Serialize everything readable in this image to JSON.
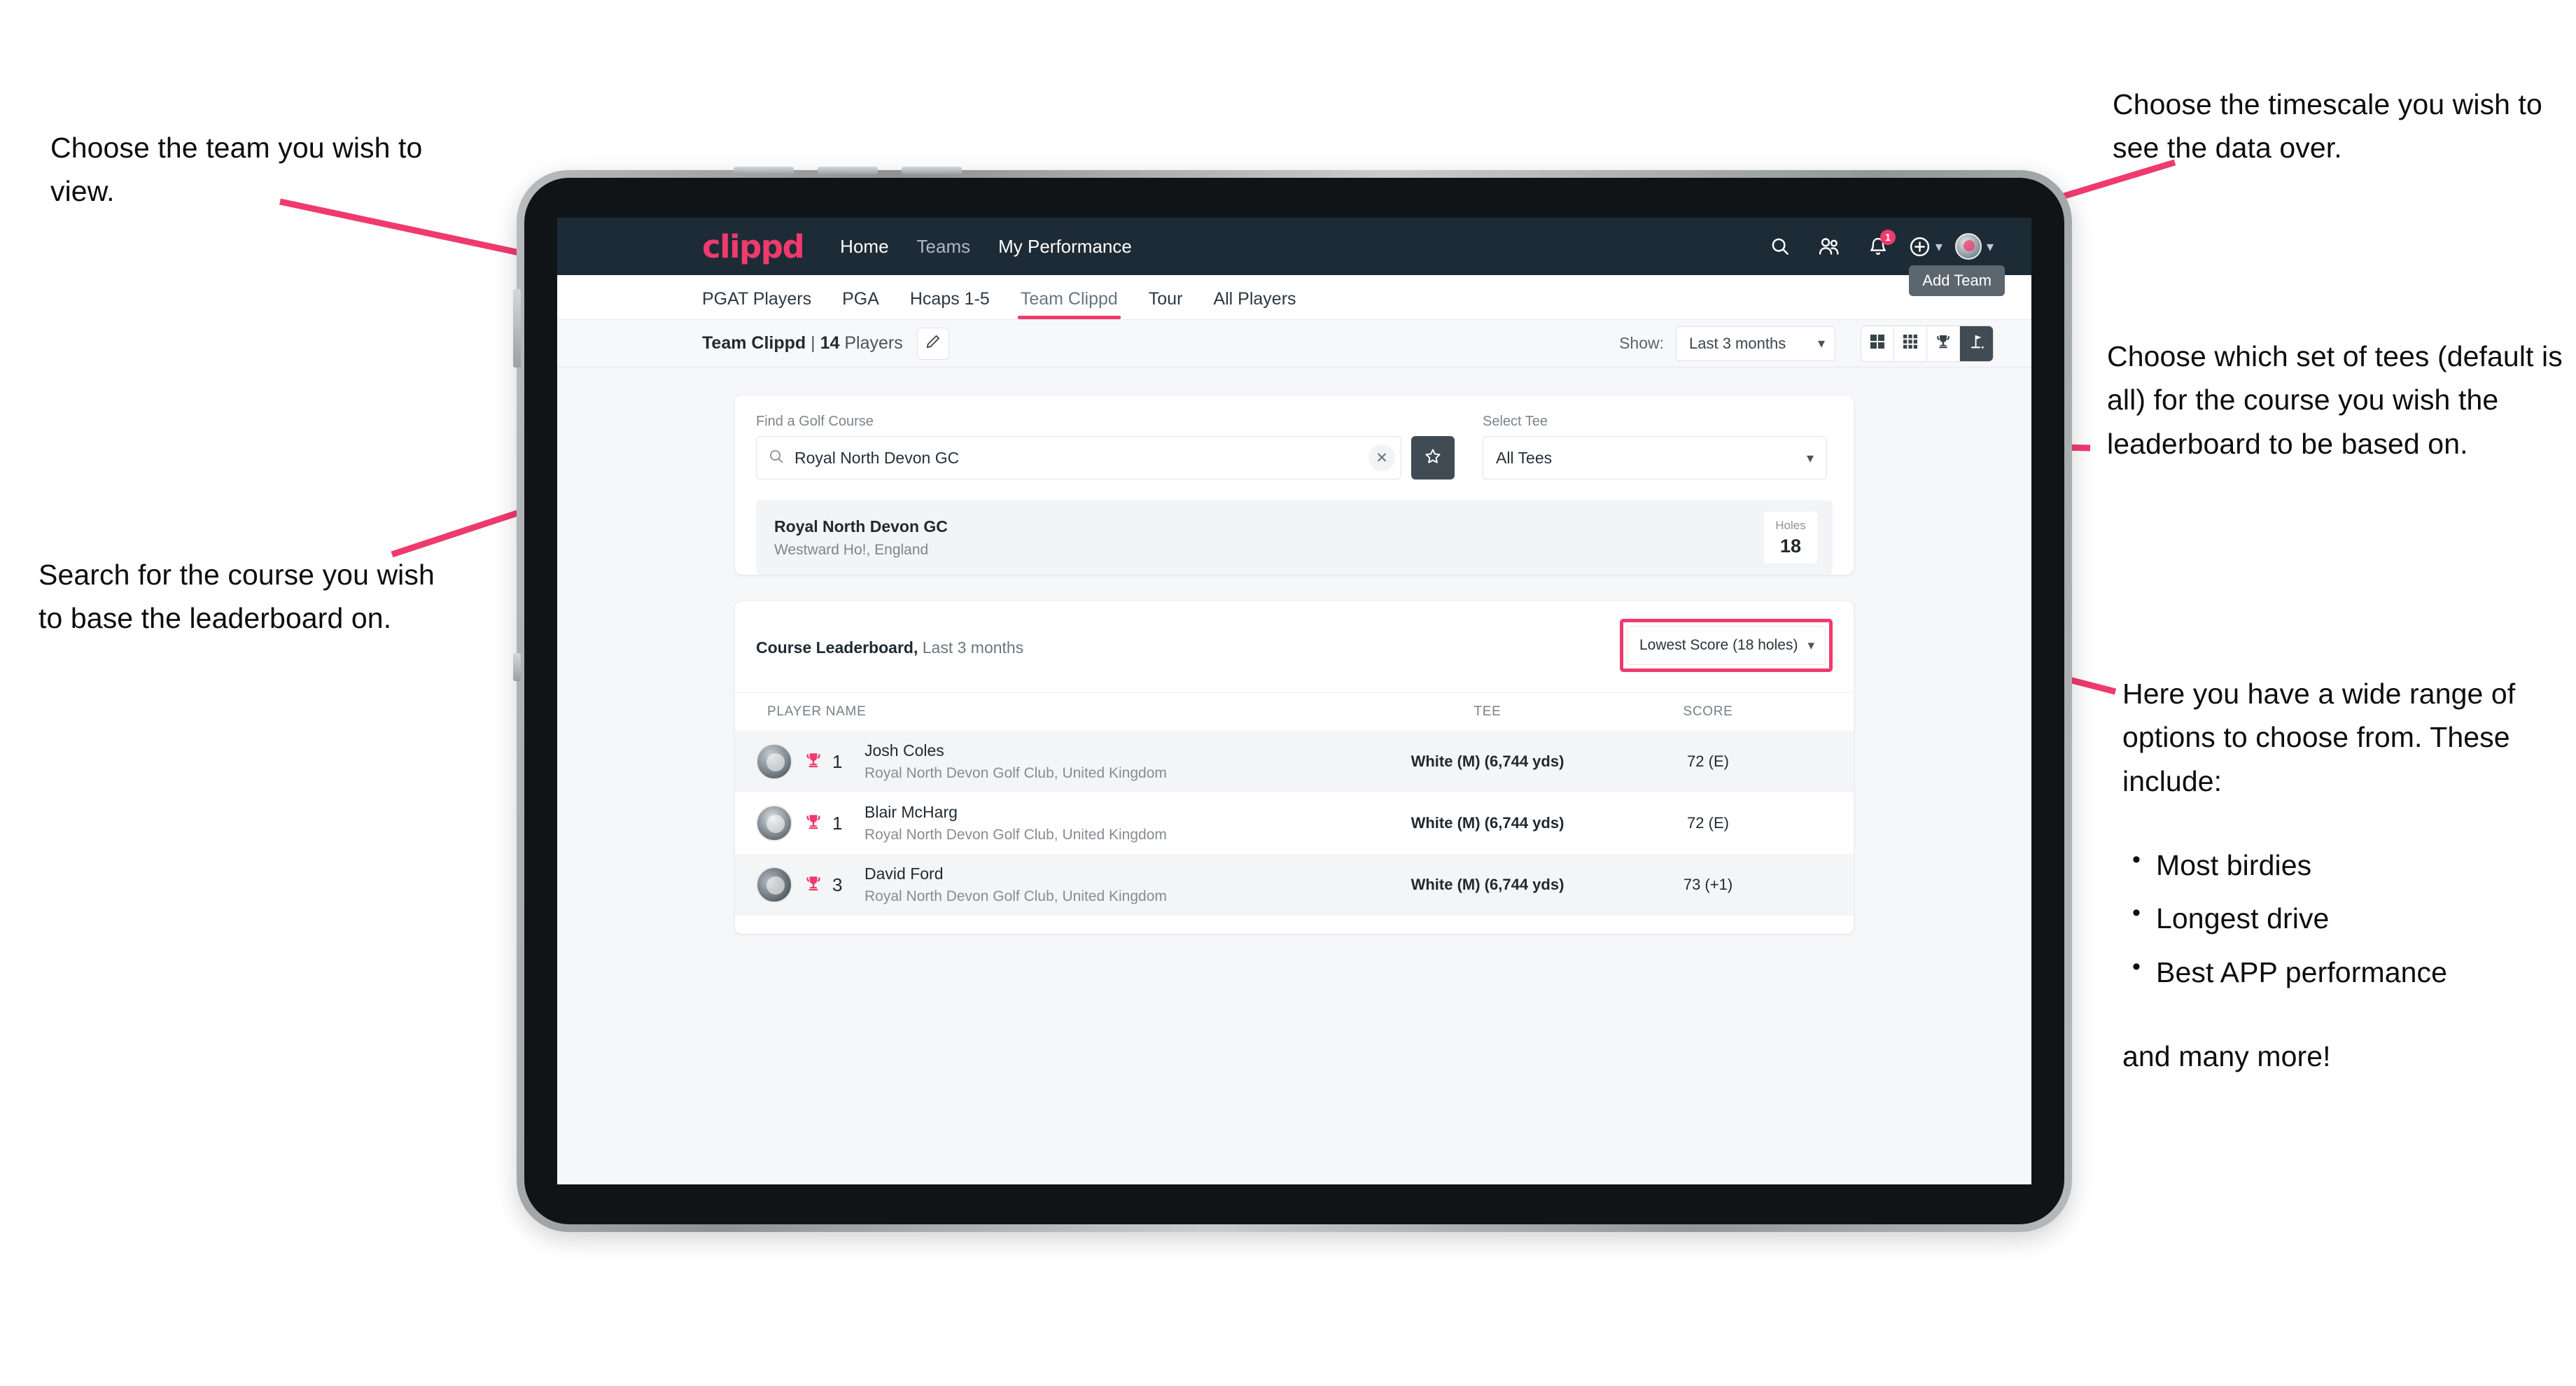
{
  "annotations": {
    "team": "Choose the team you wish to view.",
    "search": "Search for the course you wish to base the leaderboard on.",
    "timescale": "Choose the timescale you wish to see the data over.",
    "tees": "Choose which set of tees (default is all) for the course you wish the leaderboard to be based on.",
    "options_intro": "Here you have a wide range of options to choose from. These include:",
    "options_list": [
      "Most birdies",
      "Longest drive",
      "Best APP performance"
    ],
    "options_tail": "and many more!"
  },
  "appbar": {
    "brand": "clippd",
    "nav": [
      {
        "label": "Home",
        "active": true
      },
      {
        "label": "Teams",
        "active": false
      },
      {
        "label": "My Performance",
        "active": true
      }
    ],
    "icons": {
      "search": "search-icon",
      "people": "people-icon",
      "notifications": "bell-icon",
      "notification_count": "1",
      "add": "plus-circle-icon",
      "profile": "avatar-icon"
    }
  },
  "tabs": [
    {
      "label": "PGAT Players",
      "active": false
    },
    {
      "label": "PGA",
      "active": false
    },
    {
      "label": "Hcaps 1-5",
      "active": false
    },
    {
      "label": "Team Clippd",
      "active": true
    },
    {
      "label": "Tour",
      "active": false
    },
    {
      "label": "All Players",
      "active": false
    }
  ],
  "tooltip": {
    "add_team": "Add Team"
  },
  "subbar": {
    "team_name": "Team Clippd",
    "separator": "|",
    "player_count": "14",
    "players_word": "Players",
    "edit_icon": "pencil-icon",
    "show_label": "Show:",
    "show_value": "Last 3 months",
    "view_toggles": [
      {
        "icon": "grid-2x2-icon",
        "active": false
      },
      {
        "icon": "grid-3x3-icon",
        "active": false
      },
      {
        "icon": "trophy-icon",
        "active": false
      },
      {
        "icon": "golf-flag-icon",
        "active": true
      }
    ]
  },
  "search_panel": {
    "course_label": "Find a Golf Course",
    "course_value": "Royal North Devon GC",
    "course_placeholder": "Find a Golf Course",
    "clear_icon": "close-icon",
    "favourite_icon": "star-icon",
    "tee_label": "Select Tee",
    "tee_value": "All Tees"
  },
  "course_result": {
    "name": "Royal North Devon GC",
    "location": "Westward Ho!, England",
    "holes_label": "Holes",
    "holes_value": "18"
  },
  "leaderboard": {
    "title": "Course Leaderboard,",
    "subtitle": "Last 3 months",
    "metric": "Lowest Score (18 holes)",
    "columns": [
      "PLAYER NAME",
      "TEE",
      "SCORE"
    ],
    "rows": [
      {
        "rank": "1",
        "name": "Josh Coles",
        "club": "Royal North Devon Golf Club, United Kingdom",
        "tee": "White (M) (6,744 yds)",
        "score": "72 (E)"
      },
      {
        "rank": "1",
        "name": "Blair McHarg",
        "club": "Royal North Devon Golf Club, United Kingdom",
        "tee": "White (M) (6,744 yds)",
        "score": "72 (E)"
      },
      {
        "rank": "3",
        "name": "David Ford",
        "club": "Royal North Devon Golf Club, United Kingdom",
        "tee": "White (M) (6,744 yds)",
        "score": "73 (+1)"
      }
    ]
  },
  "colors": {
    "brand_pink": "#ef3a6d",
    "appbar_dark": "#1d2b36",
    "toggle_active": "#414b53",
    "page_bg": "#f6f7f9"
  }
}
